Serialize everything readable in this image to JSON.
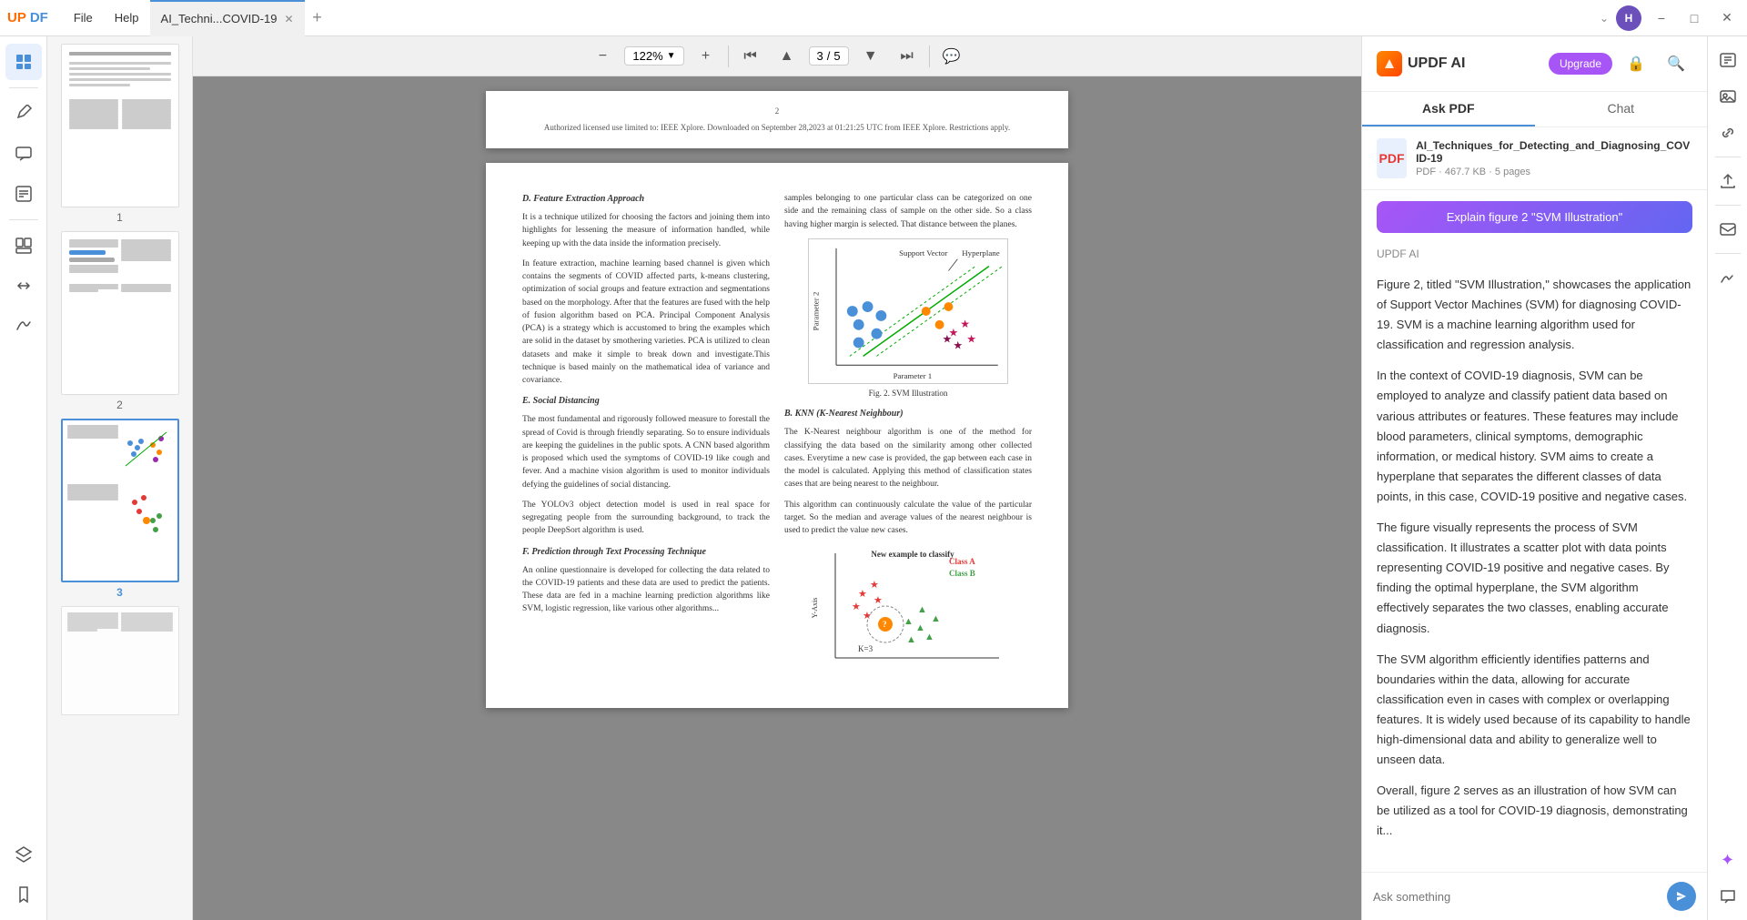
{
  "titlebar": {
    "logo_up": "UP",
    "logo_df": "DF",
    "menu_file": "File",
    "menu_help": "Help",
    "tab_name": "AI_Techni...COVID-19",
    "avatar_initials": "H",
    "chevron": "⌄"
  },
  "toolbar": {
    "zoom_value": "122%",
    "page_current": "3",
    "page_separator": "/",
    "page_total": "5"
  },
  "ai_panel": {
    "title": "UPDF AI",
    "upgrade_label": "Upgrade",
    "tab_ask_pdf": "Ask PDF",
    "tab_chat": "Chat",
    "file_name": "AI_Techniques_for_Detecting_and_Diagnosing_COVID-19",
    "file_meta": "PDF · 467.7 KB · 5 pages",
    "explain_btn": "Explain figure 2 \"SVM Illustration\"",
    "source_label": "UPDF AI",
    "response_p1": "Figure 2, titled \"SVM Illustration,\" showcases the application of Support Vector Machines (SVM) for diagnosing COVID-19. SVM is a machine learning algorithm used for classification and regression analysis.",
    "response_p2": "In the context of COVID-19 diagnosis, SVM can be employed to analyze and classify patient data based on various attributes or features. These features may include blood parameters, clinical symptoms, demographic information, or medical history. SVM aims to create a hyperplane that separates the different classes of data points, in this case, COVID-19 positive and negative cases.",
    "response_p3": "The figure visually represents the process of SVM classification. It illustrates a scatter plot with data points representing COVID-19 positive and negative cases. By finding the optimal hyperplane, the SVM algorithm effectively separates the two classes, enabling accurate diagnosis.",
    "response_p4": "The SVM algorithm efficiently identifies patterns and boundaries within the data, allowing for accurate classification even in cases with complex or overlapping features. It is widely used because of its capability to handle high-dimensional data and ability to generalize well to unseen data.",
    "response_p5": "Overall, figure 2 serves as an illustration of how SVM can be utilized as a tool for COVID-19 diagnosis, demonstrating it...",
    "input_placeholder": "Ask something"
  },
  "page1_thumb_num": "1",
  "page2_thumb_num": "2",
  "page3_thumb_num": "3",
  "page_header_text": "Authorized licensed use limited to: IEEE Xplore. Downloaded on September 28,2023 at 01:21:25 UTC from IEEE Xplore.  Restrictions apply.",
  "page_num_center": "2",
  "pdf_content": {
    "section_d_title": "D.   Feature Extraction Approach",
    "section_d_p1": "It is a technique utilized for choosing the factors and joining them into highlights for lessening the measure of information handled, while keeping up with the data inside the information precisely.",
    "section_d_p2": "In feature extraction, machine learning based channel is given which contains the segments of  COVID affected parts, k-means clustering, optimization of social groups and feature extraction and segmentations based on the morphology. After that the features are fused with the help of fusion algorithm based on PCA. Principal Component Analysis (PCA) is a strategy which is accustomed to bring the examples which are solid in the dataset by smothering varieties. PCA is utilized to clean datasets and make it simple to break down and investigate.This technique is based mainly on the mathematical idea of variance and covariance.",
    "section_e_title": "E.   Social Distancing",
    "section_e_p1": "The most fundamental and rigorously followed measure to forestall the spread of Covid is through friendly separating. So to ensure individuals are keeping the guidelines in the public spots. A CNN based algorithm is proposed which used the symptoms of COVID-19 like cough and fever. And a machine vision algorithm is used to monitor individuals defying the guidelines of social distancing.",
    "section_e_p2": "The YOLOv3 object detection model is used in real space for segregating people from the surrounding background, to track the people DeepSort algorithm is used.",
    "section_f_title": "F.   Prediction through Text Processing Technique",
    "section_f_p1": "An online questionnaire is developed for collecting the data related to the COVID-19 patients and these data are used to predict the patients. These data are fed in a machine learning prediction algorithms like SVM, logistic regression, like various other algorithms...",
    "col2_p1": "samples belonging to one particular class can be categorized on one side and the remaining class of sample on the other side. So a class having higher margin is selected. That distance between the planes.",
    "section_b_title": "B.   KNN (K-Nearest Neighbour)",
    "section_b_p1": "The K-Nearest neighbour algorithm is one of the method for classifying the data based on the similarity among other collected cases. Everytime a new case is provided, the gap between each case in the model is calculated. Applying this method of classification states cases that are being nearest to the neighbour.",
    "section_b_p2": "This algorithm can continuously calculate the value of the particular target. So the median and average values of the nearest neighbour is used to predict the value new cases.",
    "fig2_caption": "Fig. 2.   SVM Illustration",
    "fig2_label_sv": "Support Vector",
    "fig2_label_param": "Parameter 1",
    "fig2_label_hyper": "Hyperplane",
    "fig_knn_title": "New example to classify",
    "fig_knn_class_a": "Class A",
    "fig_knn_class_b": "Class B",
    "fig_knn_k": "K=3"
  }
}
